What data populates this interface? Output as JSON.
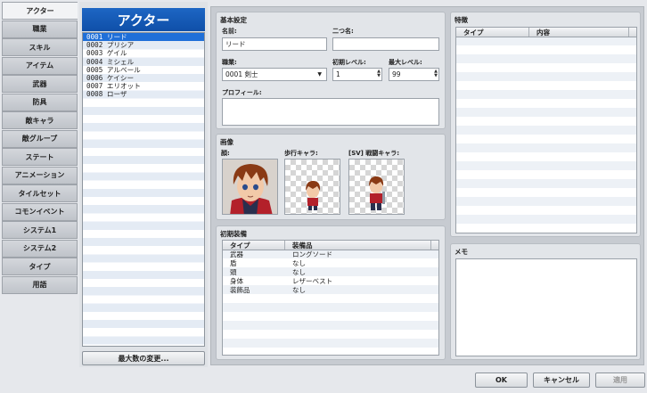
{
  "tabs": [
    "アクター",
    "職業",
    "スキル",
    "アイテム",
    "武器",
    "防具",
    "敵キャラ",
    "敵グループ",
    "ステート",
    "アニメーション",
    "タイルセット",
    "コモンイベント",
    "システム1",
    "システム2",
    "タイプ",
    "用語"
  ],
  "list": {
    "title": "アクター",
    "items": [
      "0001 リード",
      "0002 プリシア",
      "0003 ゲイル",
      "0004 ミシェル",
      "0005 アルベール",
      "0006 ケイシー",
      "0007 エリオット",
      "0008 ローザ"
    ],
    "selected_index": 0,
    "max_button": "最大数の変更..."
  },
  "basic": {
    "title": "基本設定",
    "name_label": "名前:",
    "name_value": "リード",
    "nickname_label": "二つ名:",
    "nickname_value": "",
    "class_label": "職業:",
    "class_value": "0001 剣士",
    "init_level_label": "初期レベル:",
    "init_level_value": "1",
    "max_level_label": "最大レベル:",
    "max_level_value": "99",
    "profile_label": "プロフィール:",
    "profile_value": ""
  },
  "images": {
    "title": "画像",
    "face_label": "顔:",
    "walk_label": "歩行キャラ:",
    "battler_label": "[SV] 戦闘キャラ:"
  },
  "equip": {
    "title": "初期装備",
    "col_type": "タイプ",
    "col_item": "装備品",
    "rows": [
      {
        "type": "武器",
        "item": "ロングソード"
      },
      {
        "type": "盾",
        "item": "なし"
      },
      {
        "type": "頭",
        "item": "なし"
      },
      {
        "type": "身体",
        "item": "レザーベスト"
      },
      {
        "type": "装飾品",
        "item": "なし"
      }
    ]
  },
  "traits": {
    "title": "特徴",
    "col_type": "タイプ",
    "col_content": "内容"
  },
  "memo": {
    "title": "メモ",
    "value": ""
  },
  "footer": {
    "ok": "OK",
    "cancel": "キャンセル",
    "apply": "適用"
  },
  "colors": {
    "selection": "#1f6fd8",
    "header_blue": "#0f4fa8"
  },
  "icons": {
    "spinner": "updown-arrows",
    "dropdown": "chevron-down"
  }
}
